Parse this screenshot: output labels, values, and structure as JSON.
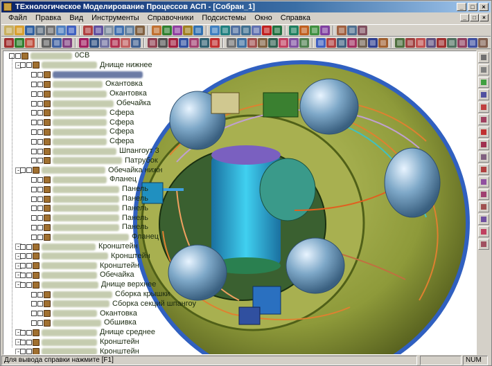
{
  "window": {
    "title": "TEхнологическое Моделирование Процессов АСП - [Собран_1]",
    "buttons": [
      "_",
      "□",
      "×"
    ]
  },
  "menu": {
    "items": [
      "Файл",
      "Правка",
      "Вид",
      "Инструменты",
      "Справочники",
      "Подсистемы",
      "Окно",
      "Справка"
    ],
    "mdi_buttons": [
      "_",
      "□",
      "×"
    ]
  },
  "toolbar1": {
    "icons": [
      "new-icon",
      "open-icon",
      "save-icon",
      "copy-icon",
      "print-icon",
      "preview-icon",
      "help-icon",
      "ks-icon",
      "properties-icon",
      "document-icon",
      "table-icon",
      "tools-icon",
      "wrench-icon",
      "library-icon",
      "grid-icon",
      "palette-icon",
      "curve-icon",
      "view1-icon",
      "view2-icon",
      "view3-icon",
      "view4-icon",
      "view5-icon",
      "view6-icon",
      "delete-icon",
      "eye-icon",
      "eye2-icon",
      "color-icon",
      "zoom-icon",
      "zoom2-icon",
      "pen-icon",
      "cube-icon",
      "layer-icon"
    ],
    "colors": [
      "#c8b060",
      "#d8a030",
      "#3060a0",
      "#607080",
      "#707070",
      "#5080c0",
      "#4060c0",
      "#b04040",
      "#6050a0",
      "#8090a0",
      "#4070b0",
      "#6080a0",
      "#806040",
      "#c07030",
      "#308030",
      "#9040a0",
      "#a08020",
      "#3070b0",
      "#4080c0",
      "#208080",
      "#5070a0",
      "#407090",
      "#6070b0",
      "#c02020",
      "#207040",
      "#208060",
      "#c06020",
      "#409040",
      "#8040a0",
      "#a06040",
      "#507090",
      "#805060"
    ]
  },
  "toolbar2": {
    "icons": [
      "wand-icon",
      "check-icon",
      "measure-icon",
      "a-icon",
      "b-icon",
      "c-icon",
      "d-icon",
      "e-icon",
      "f-icon",
      "g-icon",
      "h-icon",
      "i-icon",
      "j-icon",
      "k-icon",
      "l-icon",
      "m-icon",
      "n-icon",
      "o-icon",
      "p-icon",
      "q-icon",
      "r-icon",
      "s-icon",
      "t-icon",
      "u-icon",
      "v-icon",
      "w-icon",
      "x-icon",
      "y-icon",
      "z-icon",
      "aa-icon",
      "bb-icon",
      "cc-icon",
      "dd-icon",
      "ee-icon",
      "ff-icon",
      "gg-icon",
      "hh-icon",
      "ii-icon",
      "jj-icon",
      "kk-icon",
      "ll-icon",
      "mm-icon",
      "nn-icon"
    ],
    "colors": [
      "#a03030",
      "#308030",
      "#c05040",
      "#606060",
      "#4060a0",
      "#804080",
      "#a02060",
      "#305080",
      "#7070a0",
      "#b03050",
      "#c06060",
      "#406090",
      "#904050",
      "#505050",
      "#a02040",
      "#3050a0",
      "#a04070",
      "#306070",
      "#c03030",
      "#707070",
      "#4070a0",
      "#a05050",
      "#806040",
      "#306050",
      "#c04060",
      "#8050a0",
      "#508050",
      "#4060c0",
      "#b04040",
      "#406080",
      "#a03060",
      "#706050",
      "#304090",
      "#a06030",
      "#507040",
      "#a04040",
      "#c05050",
      "#605080",
      "#a03030",
      "#507060",
      "#904060",
      "#4050a0",
      "#806050"
    ]
  },
  "tree": {
    "root": "0CB",
    "items": [
      {
        "label": "Днище нижнее",
        "level": 1,
        "code_w": 80
      },
      {
        "label": "",
        "level": 2,
        "code_w": 130,
        "selected": true
      },
      {
        "label": "Окантовка",
        "level": 2,
        "code_w": 72
      },
      {
        "label": "Окантовка",
        "level": 2,
        "code_w": 78
      },
      {
        "label": "Обечайка",
        "level": 2,
        "code_w": 88
      },
      {
        "label": "Сфера",
        "level": 2,
        "code_w": 78
      },
      {
        "label": "Сфера",
        "level": 2,
        "code_w": 78
      },
      {
        "label": "Сфера",
        "level": 2,
        "code_w": 78
      },
      {
        "label": "Сфера",
        "level": 2,
        "code_w": 78
      },
      {
        "label": "Шпангоут 3",
        "level": 2,
        "code_w": 92
      },
      {
        "label": "Патрубок",
        "level": 2,
        "code_w": 100
      },
      {
        "label": "Обечайка нижн",
        "level": 1,
        "code_w": 92
      },
      {
        "label": "Фланец",
        "level": 2,
        "code_w": 78
      },
      {
        "label": "Панель",
        "level": 2,
        "code_w": 96
      },
      {
        "label": "Панель",
        "level": 2,
        "code_w": 96
      },
      {
        "label": "Панель",
        "level": 2,
        "code_w": 96
      },
      {
        "label": "Панель",
        "level": 2,
        "code_w": 96
      },
      {
        "label": "Панель",
        "level": 2,
        "code_w": 96
      },
      {
        "label": "Фланец",
        "level": 2,
        "code_w": 110
      },
      {
        "label": "Кронштейн",
        "level": 1,
        "code_w": 78
      },
      {
        "label": "Кронштейн",
        "level": 1,
        "code_w": 96
      },
      {
        "label": "Кронштейн",
        "level": 1,
        "code_w": 80
      },
      {
        "label": "Обечайка",
        "level": 1,
        "code_w": 80
      },
      {
        "label": "Днище верхнее",
        "level": 1,
        "code_w": 82
      },
      {
        "label": "Сборка крышки",
        "level": 2,
        "code_w": 86
      },
      {
        "label": "Сборка секций шпангоу",
        "level": 2,
        "code_w": 82
      },
      {
        "label": "Окантовка",
        "level": 2,
        "code_w": 64
      },
      {
        "label": "Обшивка",
        "level": 2,
        "code_w": 70
      },
      {
        "label": "Днище среднее",
        "level": 1,
        "code_w": 80
      },
      {
        "label": "Кронштейн",
        "level": 1,
        "code_w": 80
      },
      {
        "label": "Кронштейн",
        "level": 1,
        "code_w": 80
      }
    ]
  },
  "side_toolbar": {
    "icons": [
      "arrow-icon",
      "select-icon",
      "cursor-icon",
      "edge-icon",
      "face-icon",
      "part-icon",
      "assembly-icon",
      "pipe-icon",
      "weld-icon",
      "bolt-icon",
      "cable-icon",
      "node-icon",
      "marker-icon",
      "dim-icon",
      "note-icon",
      "check-icon"
    ],
    "colors": [
      "#707070",
      "#808080",
      "#40a040",
      "#5050a0",
      "#c04040",
      "#a04060",
      "#c03030",
      "#a03050",
      "#806080",
      "#b04040",
      "#9050a0",
      "#a04070",
      "#a05050",
      "#7050a0",
      "#c04060",
      "#a05060"
    ]
  },
  "status": {
    "help_text": "Для вывода справки нажмите [F1]",
    "num": "NUM"
  },
  "model": {
    "shell_color": "#8e9a3a",
    "tank_color": "#7ea8c8",
    "core_color": "#2ab0e0",
    "pipe_color": "#e08030"
  }
}
